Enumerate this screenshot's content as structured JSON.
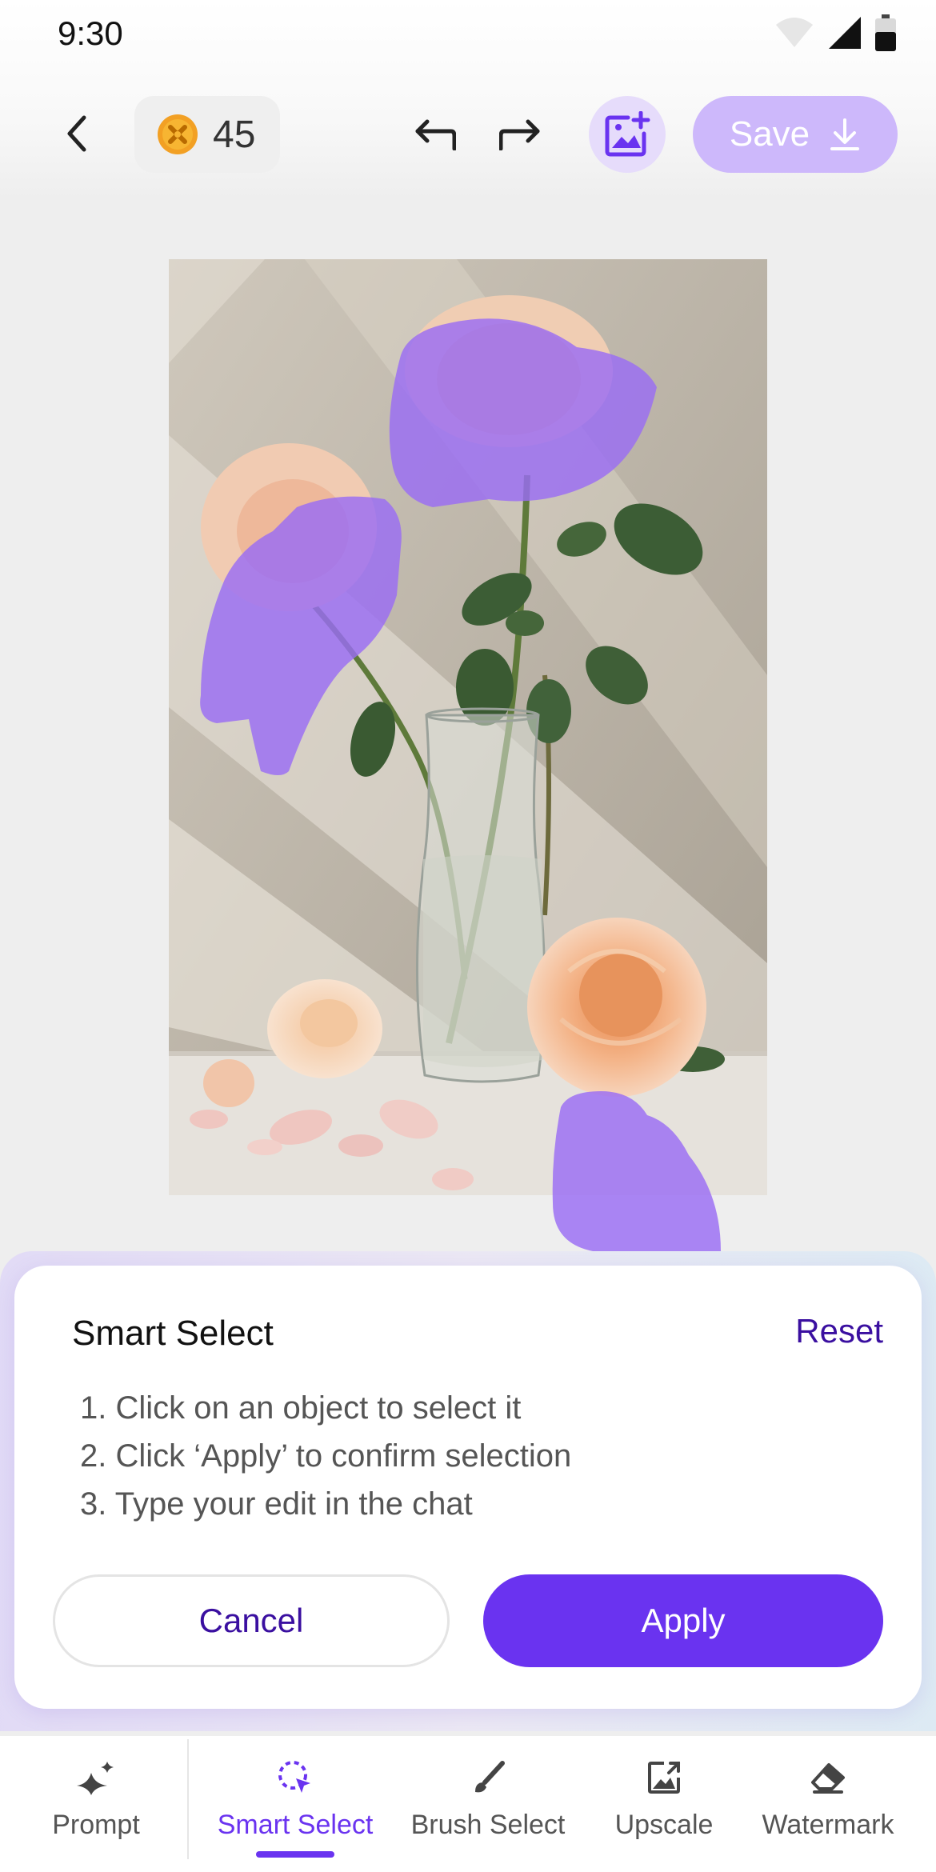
{
  "status_bar": {
    "time": "9:30"
  },
  "header": {
    "credits": "45",
    "save_label": "Save"
  },
  "smart_select_panel": {
    "title": "Smart Select",
    "reset_label": "Reset",
    "instructions": [
      "1. Click on an object to select it",
      "2. Click ‘Apply’ to confirm selection",
      "3. Type your edit in the chat"
    ],
    "cancel_label": "Cancel",
    "apply_label": "Apply"
  },
  "bottom_nav": {
    "items": [
      {
        "label": "Prompt",
        "icon": "sparkle-icon"
      },
      {
        "label": "Smart Select",
        "icon": "smart-select-icon",
        "active": true
      },
      {
        "label": "Brush Select",
        "icon": "brush-icon"
      },
      {
        "label": "Upscale",
        "icon": "upscale-icon"
      },
      {
        "label": "Watermark",
        "icon": "eraser-icon"
      }
    ]
  },
  "colors": {
    "accent": "#6a33f0",
    "accent_light": "#cdb8fb",
    "selection_overlay": "#9a6cf4",
    "reset_text": "#3a0fa0"
  }
}
